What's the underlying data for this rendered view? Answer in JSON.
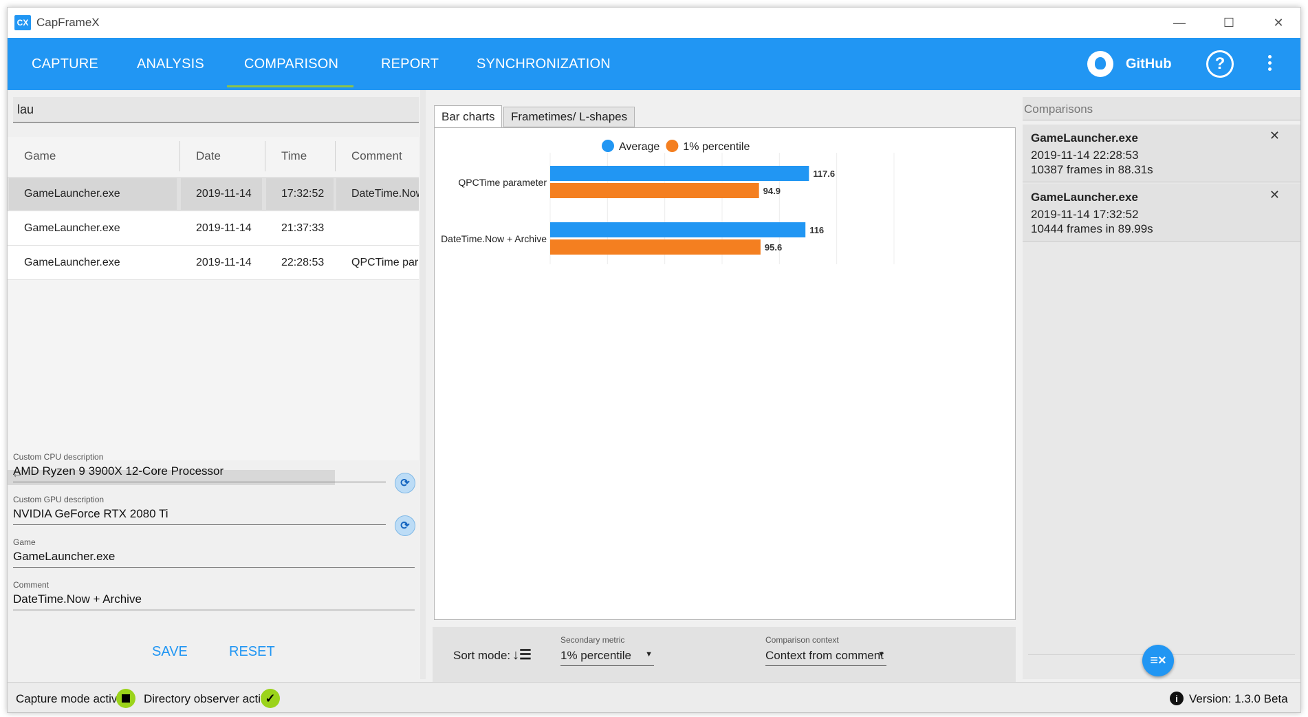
{
  "window": {
    "title": "CapFrameX",
    "logo": "CX"
  },
  "nav": {
    "items": [
      {
        "label": "CAPTURE"
      },
      {
        "label": "ANALYSIS"
      },
      {
        "label": "COMPARISON"
      },
      {
        "label": "REPORT"
      },
      {
        "label": "SYNCHRONIZATION"
      }
    ],
    "active": "COMPARISON",
    "github_label": "GitHub",
    "help_symbol": "?"
  },
  "search": {
    "value": "lau"
  },
  "records_table": {
    "columns": [
      "Game",
      "Date",
      "Time",
      "Comment"
    ],
    "rows": [
      {
        "game": "GameLauncher.exe",
        "date": "2019-11-14",
        "time": "17:32:52",
        "comment": "DateTime.Now + Archive",
        "selected": true
      },
      {
        "game": "GameLauncher.exe",
        "date": "2019-11-14",
        "time": "21:37:33",
        "comment": "",
        "selected": false
      },
      {
        "game": "GameLauncher.exe",
        "date": "2019-11-14",
        "time": "22:28:53",
        "comment": "QPCTime parameter",
        "selected": false
      }
    ]
  },
  "details": {
    "cpu_label": "Custom CPU description",
    "cpu_value": "AMD Ryzen 9 3900X 12-Core Processor",
    "gpu_label": "Custom GPU description",
    "gpu_value": "NVIDIA GeForce RTX 2080 Ti",
    "game_label": "Game",
    "game_value": "GameLauncher.exe",
    "comment_label": "Comment",
    "comment_value": "DateTime.Now + Archive",
    "save_label": "SAVE",
    "reset_label": "RESET"
  },
  "chart_tabs": [
    {
      "label": "Bar charts",
      "active": true
    },
    {
      "label": "Frametimes/ L-shapes",
      "active": false
    }
  ],
  "chart_data": {
    "type": "bar",
    "orientation": "horizontal",
    "categories": [
      "QPCTime parameter",
      "DateTime.Now + Archive"
    ],
    "series": [
      {
        "name": "Average",
        "values": [
          117.6,
          116
        ],
        "color": "#2196f3"
      },
      {
        "name": "1% percentile",
        "values": [
          94.9,
          95.6
        ],
        "color": "#f47f20"
      }
    ],
    "legend": "top-center",
    "grid": true
  },
  "bottom_controls": {
    "sort_mode_label": "Sort mode:",
    "secondary_metric_label": "Secondary metric",
    "secondary_metric_value": "1% percentile",
    "comparison_context_label": "Comparison context",
    "comparison_context_value": "Context from comment"
  },
  "comparisons": {
    "header": "Comparisons",
    "items": [
      {
        "title": "GameLauncher.exe",
        "datetime": "2019-11-14 22:28:53",
        "frames": "10387 frames in 88.31s"
      },
      {
        "title": "GameLauncher.exe",
        "datetime": "2019-11-14 17:32:52",
        "frames": "10444 frames in 89.99s"
      }
    ]
  },
  "status": {
    "capture_mode": "Capture mode active:",
    "directory_observer": "Directory observer active:",
    "version": "Version: 1.3.0 Beta"
  },
  "colors": {
    "accent": "#2196f3",
    "nav_underline": "#8bc34a",
    "indicator": "#9bd31a",
    "series_orange": "#f47f20"
  }
}
